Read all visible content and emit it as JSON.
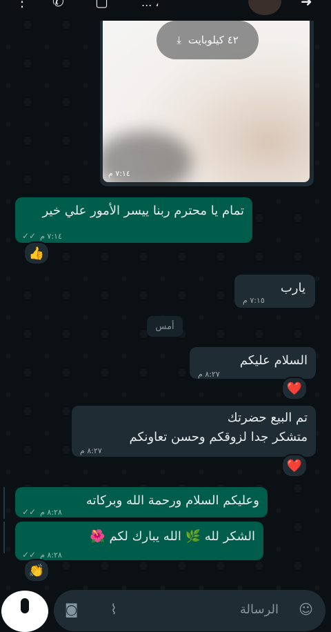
{
  "header": {
    "name": "... ،",
    "icons": [
      "more-icon",
      "call-icon",
      "video-call-icon",
      "back-arrow-icon"
    ]
  },
  "media": {
    "download_size": "٤٢ كيلوبايت",
    "time": "٧:١٤ م"
  },
  "messages": [
    {
      "text": "تمام يا محترم ربنا ييسر الأمور علي خير",
      "time": "٧:١٤ م",
      "direction": "out",
      "reaction": "👍"
    },
    {
      "text": "يارب",
      "time": "٧:١٥ م",
      "direction": "in"
    },
    {
      "text": "السلام عليكم",
      "time": "٨:٢٧ م",
      "direction": "in",
      "reaction": "❤️"
    },
    {
      "line1": "تم البيع حضرتك",
      "line2": "متشكر جدا لزوقكم وحسن تعاونكم",
      "time": "٨:٢٧ م",
      "direction": "in",
      "reaction": "❤️"
    },
    {
      "text": "وعليكم السلام ورحمة الله وبركاته",
      "time": "٨:٢٨ م",
      "direction": "out"
    },
    {
      "text": "الشكر لله 🌿 الله يبارك لكم 🌺",
      "time": "٨:٢٨ م",
      "direction": "out",
      "reaction": "👏"
    }
  ],
  "date_divider": "أمس",
  "composer": {
    "placeholder": "الرسالة"
  },
  "colors": {
    "outgoing": "#005c4b",
    "incoming": "#202c33",
    "background": "#0b1014"
  }
}
